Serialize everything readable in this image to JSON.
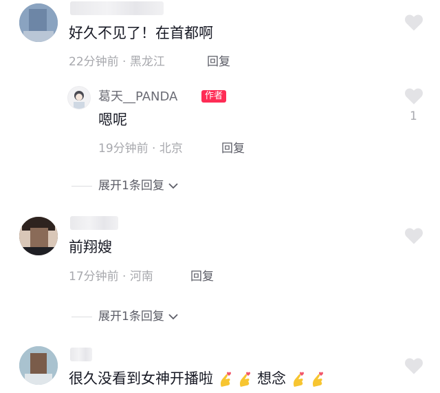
{
  "colors": {
    "accent": "#fe2c55",
    "meta": "#a7a8ad",
    "text": "#161823"
  },
  "comments": [
    {
      "text": "好久不见了！在首都啊",
      "time": "22分钟前",
      "location": "黑龙江",
      "reply_label": "回复",
      "replies": [
        {
          "author": "葛天__PANDA",
          "author_tag": "作者",
          "text": "嗯呢",
          "time": "19分钟前",
          "location": "北京",
          "reply_label": "回复",
          "like_count": "1"
        }
      ],
      "expand_label": "展开1条回复"
    },
    {
      "text": "前翔嫂",
      "time": "17分钟前",
      "location": "河南",
      "reply_label": "回复",
      "expand_label": "展开1条回复"
    },
    {
      "text_part1": "很久没看到女神开播啦",
      "text_part2": "想念",
      "emoji_name": "finger-heart-emoji"
    }
  ],
  "separator": "·",
  "icons": [
    "heart-icon",
    "chevron-down-icon",
    "finger-heart-emoji"
  ]
}
